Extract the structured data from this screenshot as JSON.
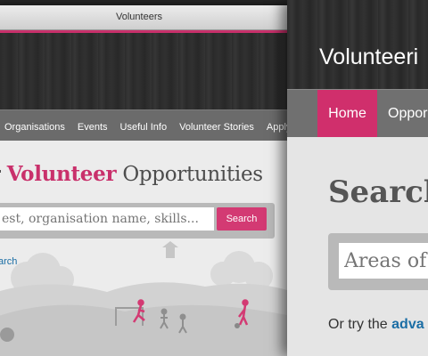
{
  "back_window": {
    "title": "Volunteers",
    "nav": [
      "Organisations",
      "Events",
      "Useful Info",
      "Volunteer Stories",
      "Apply"
    ],
    "heading": {
      "prefix": "r",
      "highlight": "Volunteer",
      "suffix": "Opportunities"
    },
    "search": {
      "placeholder": "est, organisation name, skills...",
      "button": "Search"
    },
    "advanced_link": "arch"
  },
  "front_window": {
    "title": "Volunteeri",
    "nav": {
      "home": "Home",
      "opportunities": "Oppor"
    },
    "heading": "Search",
    "search": {
      "placeholder": "Areas of"
    },
    "footer": {
      "prefix": "Or try the",
      "link": "adva"
    }
  },
  "colors": {
    "accent": "#c9306b",
    "link": "#1b6ea5",
    "nav": "#6b6b6b"
  }
}
